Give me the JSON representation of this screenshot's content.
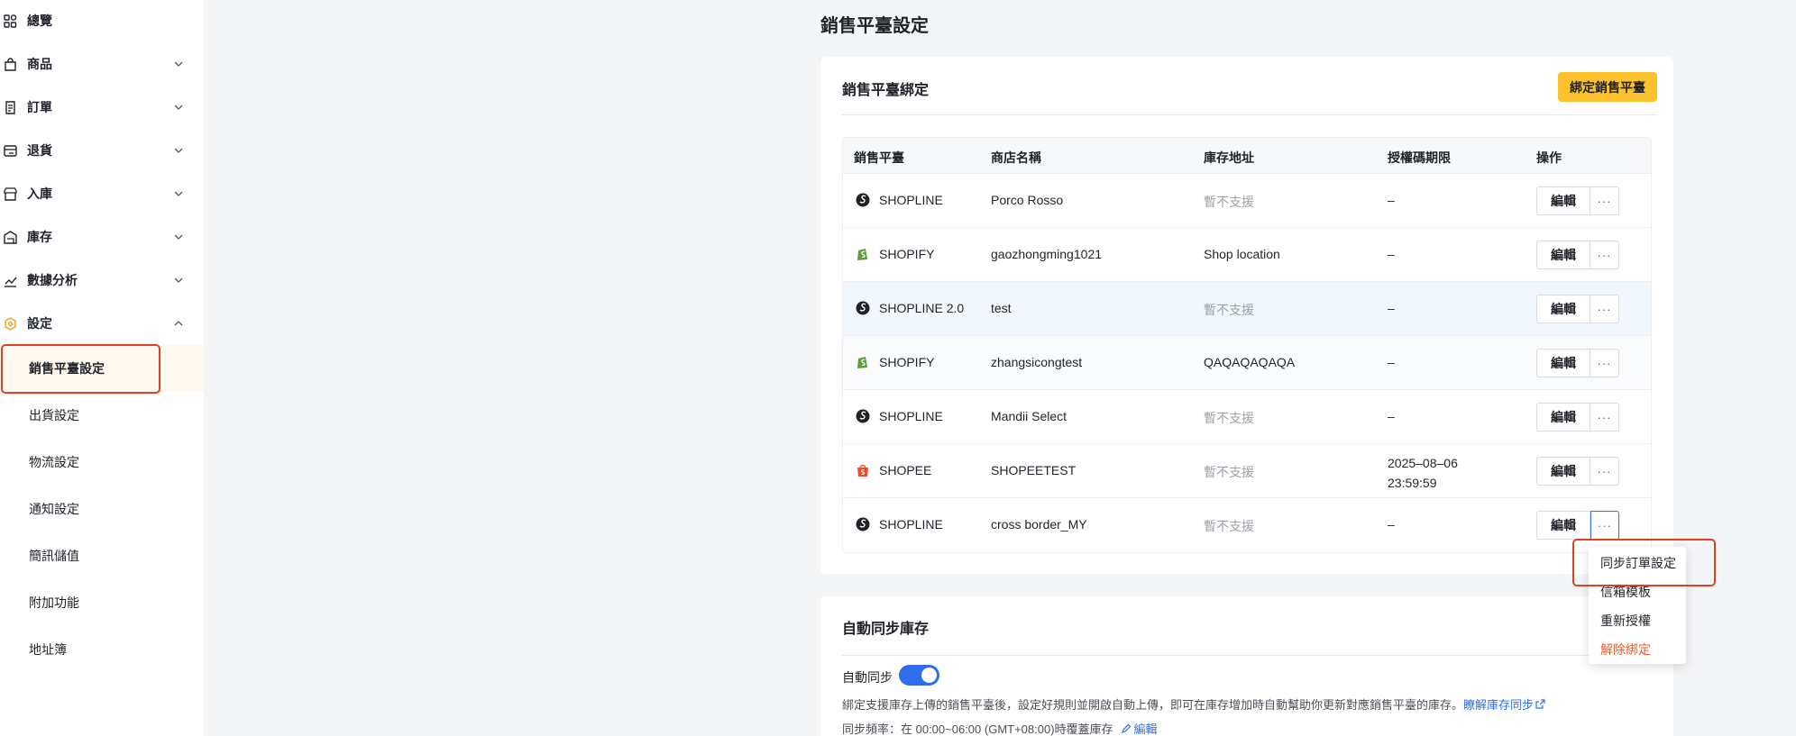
{
  "sidebar": {
    "items": [
      {
        "label": "總覽",
        "icon": "dashboard-icon"
      },
      {
        "label": "商品",
        "icon": "bag-icon"
      },
      {
        "label": "訂單",
        "icon": "order-icon"
      },
      {
        "label": "退貨",
        "icon": "return-icon"
      },
      {
        "label": "入庫",
        "icon": "inbound-icon"
      },
      {
        "label": "庫存",
        "icon": "warehouse-icon"
      },
      {
        "label": "數據分析",
        "icon": "chart-icon"
      },
      {
        "label": "設定",
        "icon": "settings-icon"
      }
    ],
    "sub_items": [
      {
        "label": "銷售平臺設定",
        "active": true
      },
      {
        "label": "出貨設定"
      },
      {
        "label": "物流設定"
      },
      {
        "label": "通知設定"
      },
      {
        "label": "簡訊儲值"
      },
      {
        "label": "附加功能"
      },
      {
        "label": "地址簿"
      }
    ]
  },
  "page": {
    "title": "銷售平臺設定"
  },
  "binding": {
    "title": "銷售平臺綁定",
    "bind_button": "綁定銷售平臺",
    "columns": [
      "銷售平臺",
      "商店名稱",
      "庫存地址",
      "授權碼期限",
      "操作"
    ],
    "rows": [
      {
        "platform": "SHOPLINE",
        "icon": "shopline-icon",
        "store": "Porco Rosso",
        "address": "暫不支援",
        "address_muted": true,
        "expiry": "–"
      },
      {
        "platform": "SHOPIFY",
        "icon": "shopify-icon",
        "store": "gaozhongming1021",
        "address": "Shop location",
        "address_muted": false,
        "expiry": "–"
      },
      {
        "platform": "SHOPLINE 2.0",
        "icon": "shopline-icon",
        "store": "test",
        "address": "暫不支援",
        "address_muted": true,
        "expiry": "–"
      },
      {
        "platform": "SHOPIFY",
        "icon": "shopify-icon",
        "store": "zhangsicongtest",
        "address": "QAQAQAQAQA",
        "address_muted": false,
        "expiry": "–"
      },
      {
        "platform": "SHOPLINE",
        "icon": "shopline-icon",
        "store": "Mandii Select",
        "address": "暫不支援",
        "address_muted": true,
        "expiry": "–"
      },
      {
        "platform": "SHOPEE",
        "icon": "shopee-icon",
        "store": "SHOPEETEST",
        "address": "暫不支援",
        "address_muted": true,
        "expiry": "2025–08–06 23:59:59"
      },
      {
        "platform": "SHOPLINE",
        "icon": "shopline-icon",
        "store": "cross border_MY",
        "address": "暫不支援",
        "address_muted": true,
        "expiry": "–"
      }
    ],
    "edit_label": "編輯",
    "more_label": "···"
  },
  "dropdown": {
    "items": [
      "同步訂單設定",
      "信箱模板",
      "重新授權",
      "解除綁定"
    ]
  },
  "auto_sync": {
    "title": "自動同步庫存",
    "toggle_label": "自動同步",
    "toggle_on": true,
    "description": "綁定支援庫存上傳的銷售平臺後，設定好規則並開啟自動上傳，即可在庫存增加時自動幫助你更新對應銷售平臺的庫存。",
    "learn_link": "瞭解庫存同步",
    "frequency": "同步頻率：在 00:00~06:00 (GMT+08:00)時覆蓋庫存",
    "edit_link": "編輯"
  },
  "colors": {
    "accent": "#fcc12b",
    "link": "#2f6ded",
    "danger": "#f05a28",
    "highlight": "#e0401f"
  }
}
